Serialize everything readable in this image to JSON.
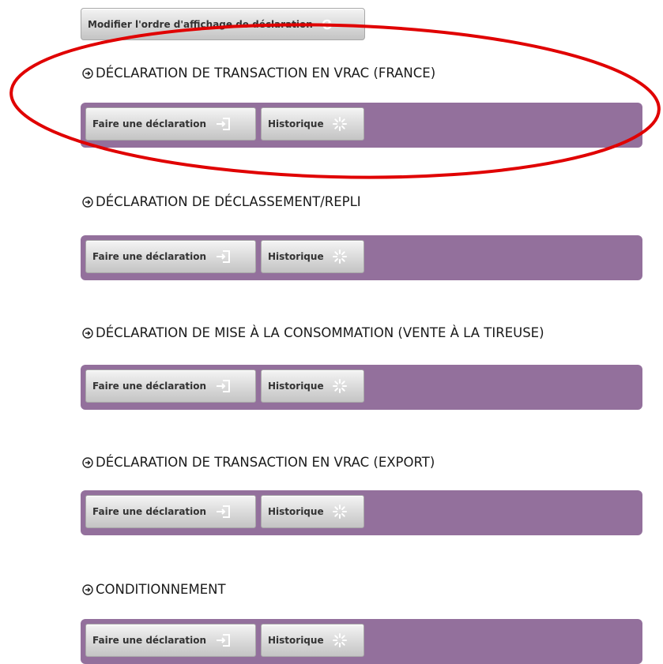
{
  "top_button": {
    "label": "Modifier l'ordre d'affichage de déclaration",
    "icon": "refresh-icon"
  },
  "sections": [
    {
      "title": "DÉCLARATION DE TRANSACTION EN VRAC (FRANCE)",
      "declare_label": "Faire une déclaration",
      "history_label": "Historique"
    },
    {
      "title": "DÉCLARATION DE DÉCLASSEMENT/REPLI",
      "declare_label": "Faire une déclaration",
      "history_label": "Historique"
    },
    {
      "title": "DÉCLARATION DE MISE À LA CONSOMMATION (VENTE À LA TIREUSE)",
      "declare_label": "Faire une déclaration",
      "history_label": "Historique"
    },
    {
      "title": "DÉCLARATION DE TRANSACTION EN VRAC (EXPORT)",
      "declare_label": "Faire une déclaration",
      "history_label": "Historique"
    },
    {
      "title": "CONDITIONNEMENT",
      "declare_label": "Faire une déclaration",
      "history_label": "Historique"
    }
  ],
  "icons": {
    "section": "circle-arrow-right-icon",
    "declare": "sign-in-icon",
    "history": "spinner-icon"
  },
  "colors": {
    "bar": "#93709c",
    "annotation": "#e00000"
  }
}
